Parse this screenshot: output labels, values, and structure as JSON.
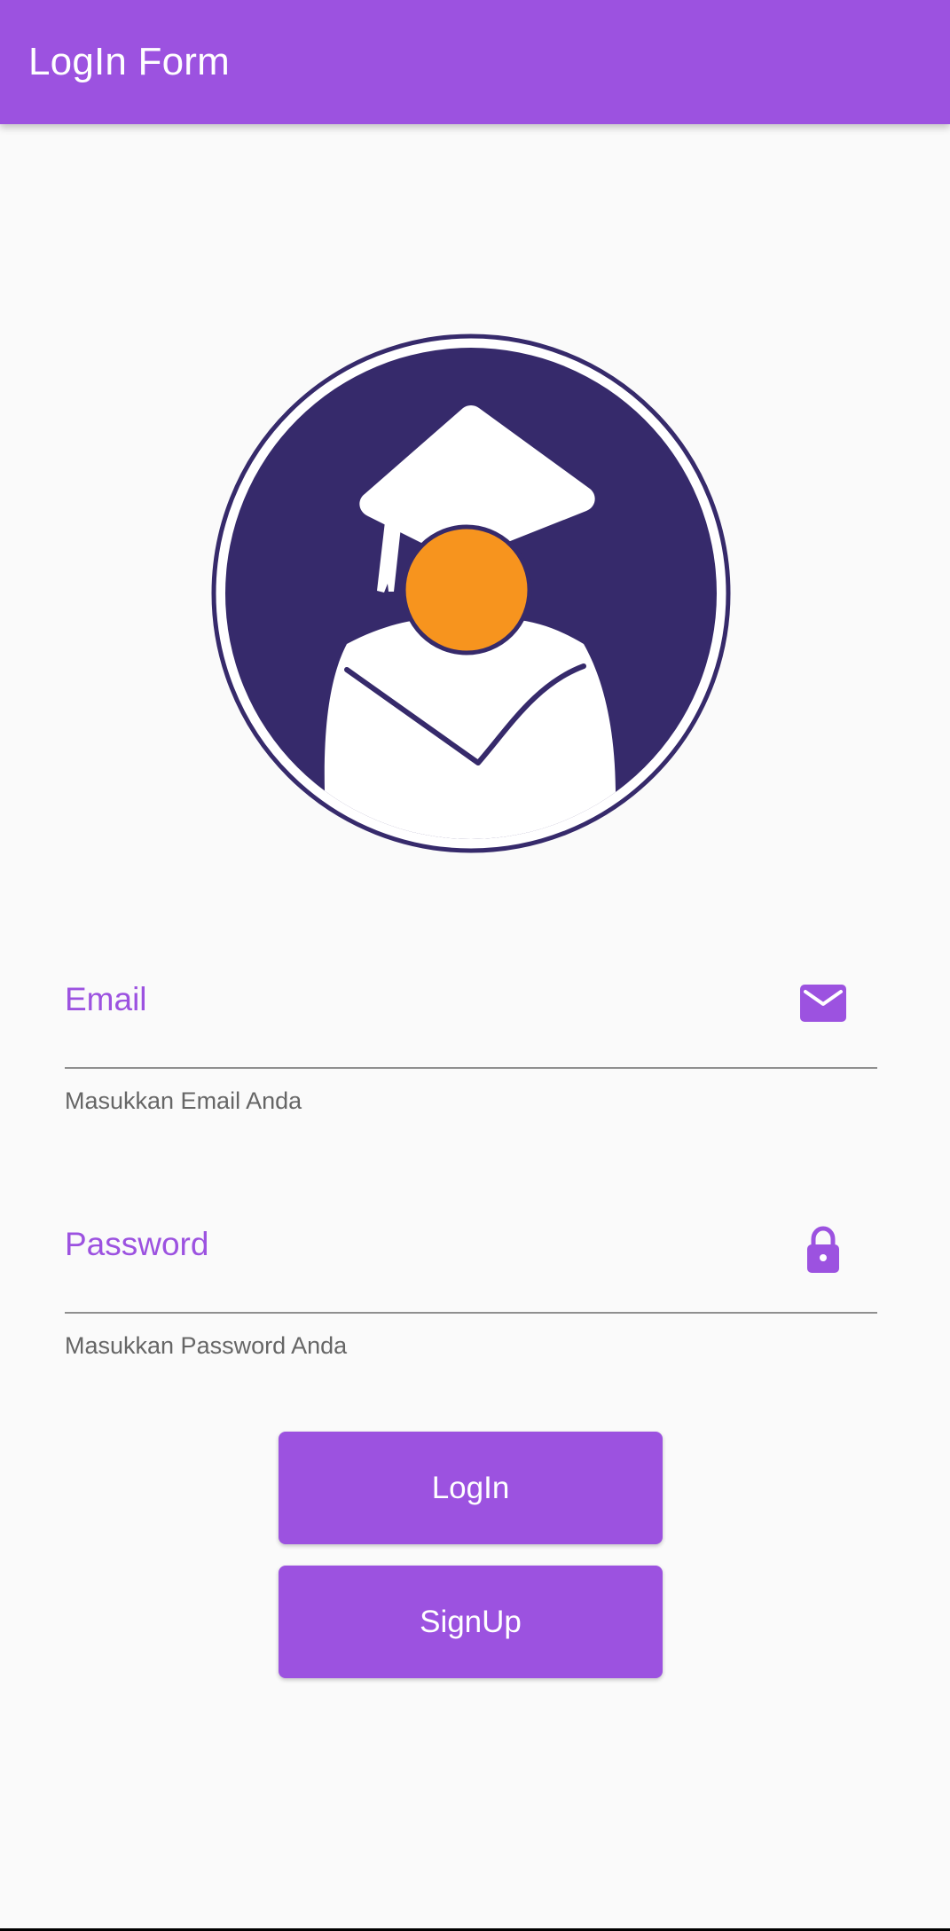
{
  "app_bar": {
    "title": "LogIn Form",
    "color": "#9c52e0"
  },
  "avatar": {
    "icon": "graduate-avatar-icon",
    "colors": {
      "circle": "#362a6b",
      "face": "#f7941e",
      "gown": "#ffffff"
    }
  },
  "email_field": {
    "label": "Email",
    "helper": "Masukkan Email Anda",
    "icon": "mail-icon"
  },
  "password_field": {
    "label": "Password",
    "helper": "Masukkan Password Anda",
    "icon": "lock-icon"
  },
  "buttons": {
    "login_label": "LogIn",
    "signup_label": "SignUp"
  },
  "theme": {
    "accent": "#9c52e0",
    "background": "#fafafa",
    "helper_text": "#666666",
    "underline": "#8f8f8f"
  }
}
